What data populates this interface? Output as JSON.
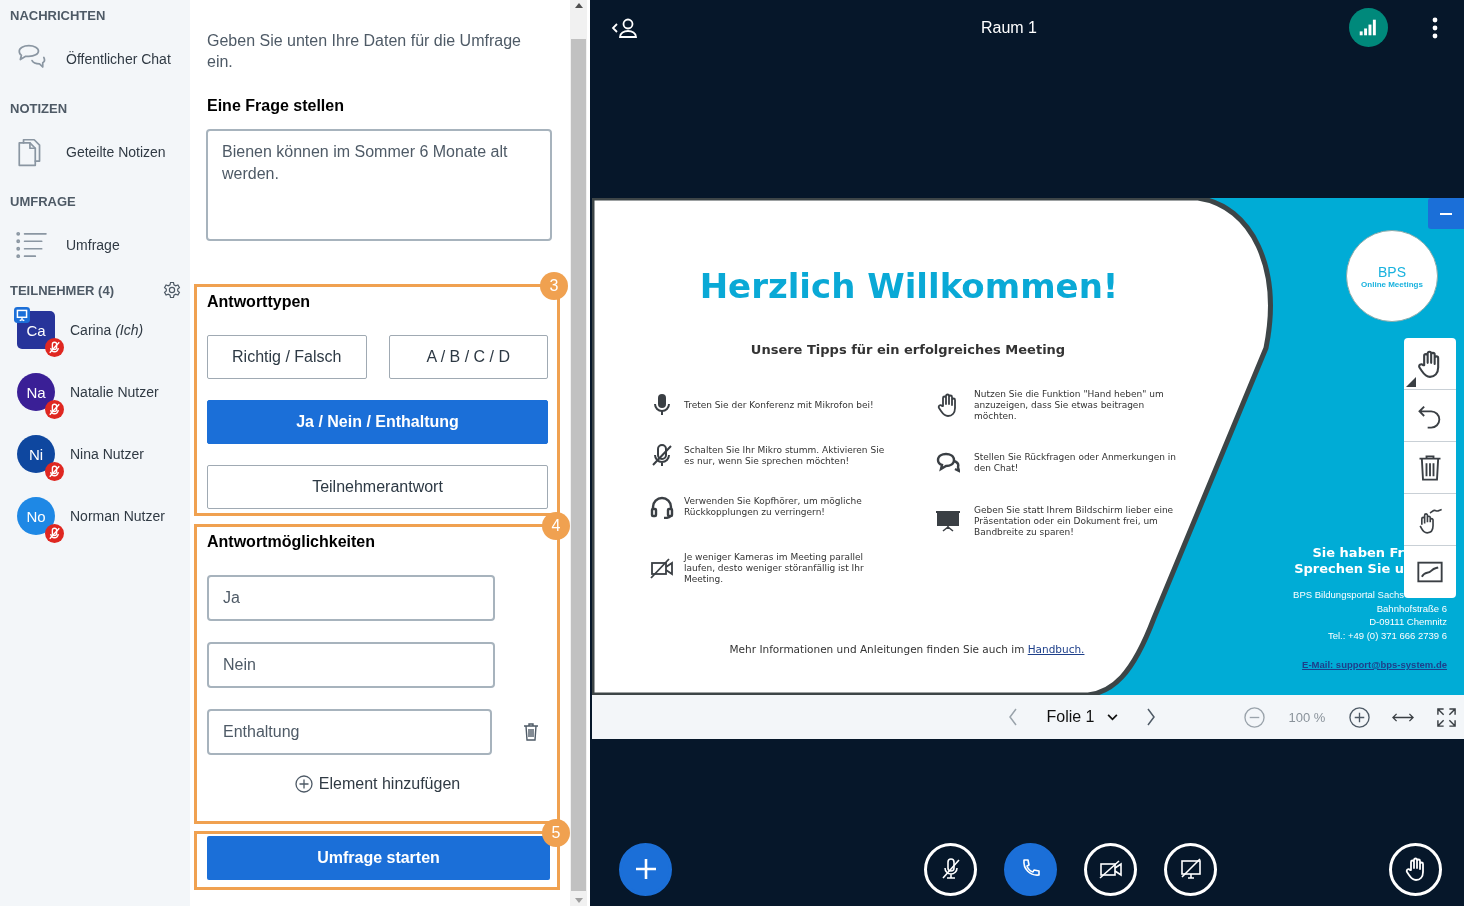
{
  "sidebar": {
    "sections": [
      {
        "heading": "NACHRICHTEN",
        "items": [
          {
            "label": "Öffentlicher Chat"
          }
        ]
      },
      {
        "heading": "NOTIZEN",
        "items": [
          {
            "label": "Geteilte Notizen"
          }
        ]
      },
      {
        "heading": "UMFRAGE",
        "items": [
          {
            "label": "Umfrage"
          }
        ]
      }
    ],
    "participants": {
      "heading": "TEILNEHMER (4)",
      "users": [
        {
          "initials": "Ca",
          "name": "Carina",
          "suffix": "(Ich)",
          "color": "#27349a",
          "presenter": true,
          "muted": true
        },
        {
          "initials": "Na",
          "name": "Natalie Nutzer",
          "color": "#3a1f96",
          "presenter": false,
          "muted": true
        },
        {
          "initials": "Ni",
          "name": "Nina Nutzer",
          "color": "#0e479f",
          "presenter": false,
          "muted": true
        },
        {
          "initials": "No",
          "name": "Norman Nutzer",
          "color": "#1e88e5",
          "presenter": false,
          "muted": true
        }
      ]
    }
  },
  "poll": {
    "intro": "Geben Sie unten Ihre Daten für die Umfrage ein.",
    "question_label": "Eine Frage stellen",
    "question": "Bienen können im Sommer 6 Monate alt werden.",
    "answer_types": {
      "badge": "3",
      "heading": "Antworttypen",
      "options": [
        {
          "label": "Richtig / Falsch",
          "selected": false
        },
        {
          "label": "A / B / C / D",
          "selected": false
        },
        {
          "label": "Ja / Nein / Enthaltung",
          "selected": true
        },
        {
          "label": "Teilnehmerantwort",
          "selected": false
        }
      ]
    },
    "answers": {
      "badge": "4",
      "heading": "Antwortmöglichkeiten",
      "items": [
        {
          "value": "Ja",
          "deletable": false
        },
        {
          "value": "Nein",
          "deletable": false
        },
        {
          "value": "Enthaltung",
          "deletable": true
        }
      ],
      "add_label": "Element hinzufügen"
    },
    "start": {
      "badge": "5",
      "label": "Umfrage starten"
    }
  },
  "topbar": {
    "title": "Raum 1"
  },
  "slide": {
    "title": "Herzlich Willkommen!",
    "subtitle": "Unsere Tipps für ein erfolgreiches Meeting",
    "tips_left": [
      "Treten Sie der Konferenz mit Mikrofon bei!",
      "Schalten Sie Ihr Mikro stumm. Aktivieren Sie es nur, wenn Sie sprechen möchten!",
      "Verwenden Sie Kopfhörer, um mögliche Rückkopplungen zu verringern!",
      "Je weniger Kameras im Meeting parallel laufen, desto weniger störanfällig ist Ihr Meeting."
    ],
    "tips_right": [
      "Nutzen Sie die Funktion \"Hand heben\" um anzuzeigen, dass Sie etwas beitragen möchten.",
      "Stellen Sie Rückfragen oder Anmerkungen in den Chat!",
      "Geben Sie statt Ihrem Bildschirm lieber eine Präsentation oder ein Dokument frei, um Bandbreite zu sparen!"
    ],
    "footer": "Mehr Informationen und Anleitungen finden Sie auch im",
    "footer_link": "Handbuch.",
    "logo": {
      "line1": "BPS",
      "line2": "Online Meetings"
    },
    "contact_heading": [
      "Sie haben Fr",
      "Sprechen Sie u"
    ],
    "contact_lines": [
      "BPS Bildungsportal Sachs",
      "Bahnhofstraße 6",
      "D-09111 Chemnitz",
      "Tel.: +49 (0) 371 666 2739 6"
    ],
    "email": "E-Mail: support@bps-system.de"
  },
  "slide_toolbar": {
    "slide": "Folie 1",
    "zoom": "100 %"
  }
}
